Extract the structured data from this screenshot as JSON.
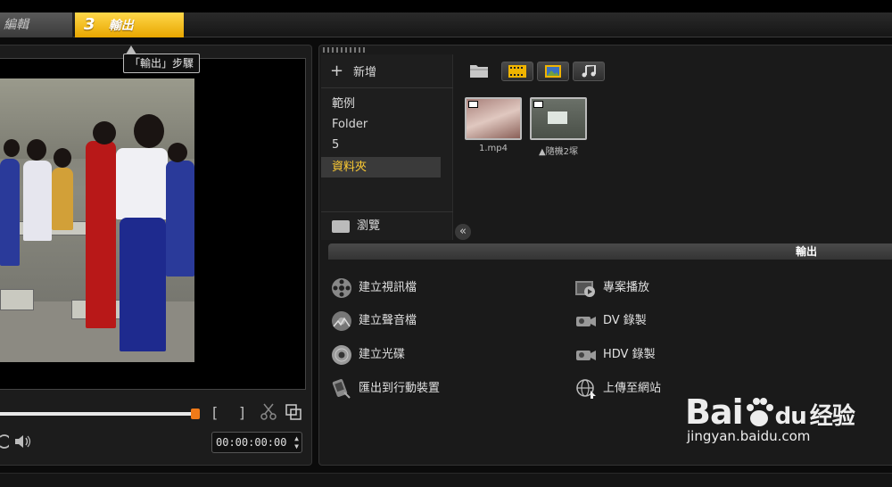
{
  "steps": {
    "edit_label": "編輯",
    "output_number": "3",
    "output_label": "輸出"
  },
  "tooltip": "「輸出」步驟",
  "player": {
    "timecode": "00:00:00:00",
    "spin_up": "▲",
    "spin_down": "▼",
    "mark_in": "[",
    "mark_out": "]",
    "progress": 0.22
  },
  "library": {
    "add_label": "新增",
    "folders": [
      "範例",
      "Folder",
      "5",
      "資料夾"
    ],
    "active_folder": 3,
    "browse_label": "瀏覽",
    "collapse_glyph": "«",
    "media": [
      {
        "name": "1.mp4"
      },
      {
        "name": "▲隨機2塚"
      }
    ]
  },
  "output": {
    "header": "輸出",
    "left_items": [
      "建立視訊檔",
      "建立聲音檔",
      "建立光碟",
      "匯出到行動裝置"
    ],
    "right_items": [
      "專案播放",
      "DV 錄製",
      "HDV 錄製",
      "上傳至網站"
    ]
  },
  "watermark": {
    "logo_a": "Bai",
    "logo_b": "du",
    "logo_c": "经验",
    "url": "jingyan.baidu.com"
  },
  "colors": {
    "accent": "#f0b400",
    "active_text": "#ffcc33",
    "scrub_handle": "#f07a18"
  }
}
